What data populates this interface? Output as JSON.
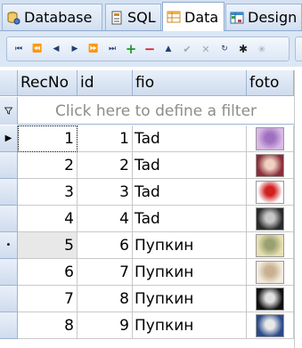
{
  "tabs": [
    {
      "label": "Database",
      "icon": "database-icon",
      "active": false
    },
    {
      "label": "SQL",
      "icon": "sql-icon",
      "active": false
    },
    {
      "label": "Data",
      "icon": "data-grid-icon",
      "active": true
    },
    {
      "label": "Design",
      "icon": "design-grid-icon",
      "active": false
    }
  ],
  "toolbar": {
    "buttons": [
      {
        "name": "first-record-button",
        "glyph": "⏮"
      },
      {
        "name": "prior-page-button",
        "glyph": "⏪"
      },
      {
        "name": "prior-record-button",
        "glyph": "◀"
      },
      {
        "name": "next-record-button",
        "glyph": "▶"
      },
      {
        "name": "next-page-button",
        "glyph": "⏩"
      },
      {
        "name": "last-record-button",
        "glyph": "⏭"
      },
      {
        "name": "insert-record-button",
        "glyph": "+"
      },
      {
        "name": "delete-record-button",
        "glyph": "−"
      },
      {
        "name": "edit-record-button",
        "glyph": "▲"
      },
      {
        "name": "post-edit-button",
        "glyph": "✔"
      },
      {
        "name": "cancel-edit-button",
        "glyph": "✕"
      },
      {
        "name": "refresh-button",
        "glyph": "↻"
      },
      {
        "name": "bookmark-button",
        "glyph": "✱"
      },
      {
        "name": "goto-bookmark-button",
        "glyph": "✳"
      }
    ]
  },
  "grid": {
    "columns": [
      "RecNo",
      "id",
      "fio",
      "foto"
    ],
    "filter_placeholder": "Click here to define a filter",
    "rows": [
      {
        "recno": "1",
        "id": "1",
        "fio": "Tad",
        "indicator": "▶",
        "thumb": [
          "#d9b8e6",
          "#a070c0"
        ]
      },
      {
        "recno": "2",
        "id": "2",
        "fio": "Tad",
        "indicator": "",
        "thumb": [
          "#8a2e3a",
          "#f0d0c0"
        ]
      },
      {
        "recno": "3",
        "id": "3",
        "fio": "Tad",
        "indicator": "",
        "thumb": [
          "#ffffff",
          "#d02020"
        ]
      },
      {
        "recno": "4",
        "id": "4",
        "fio": "Tad",
        "indicator": "",
        "thumb": [
          "#2a2a2a",
          "#c8c8c8"
        ]
      },
      {
        "recno": "5",
        "id": "6",
        "fio": "Пупкин",
        "indicator": "•",
        "thumb": [
          "#e8e0b0",
          "#9aa070"
        ]
      },
      {
        "recno": "6",
        "id": "7",
        "fio": "Пупкин",
        "indicator": "",
        "thumb": [
          "#f2ece0",
          "#c8b090"
        ]
      },
      {
        "recno": "7",
        "id": "8",
        "fio": "Пупкин",
        "indicator": "",
        "thumb": [
          "#101010",
          "#e0e0e0"
        ]
      },
      {
        "recno": "8",
        "id": "9",
        "fio": "Пупкин",
        "indicator": "",
        "thumb": [
          "#2a4a8a",
          "#e8e8e8"
        ]
      }
    ]
  },
  "colors": {
    "tab_bar": "#d4e1f2",
    "header": "#cfdcee",
    "grid_line": "#c9c9c9",
    "filter_text": "#8c8c8c"
  }
}
